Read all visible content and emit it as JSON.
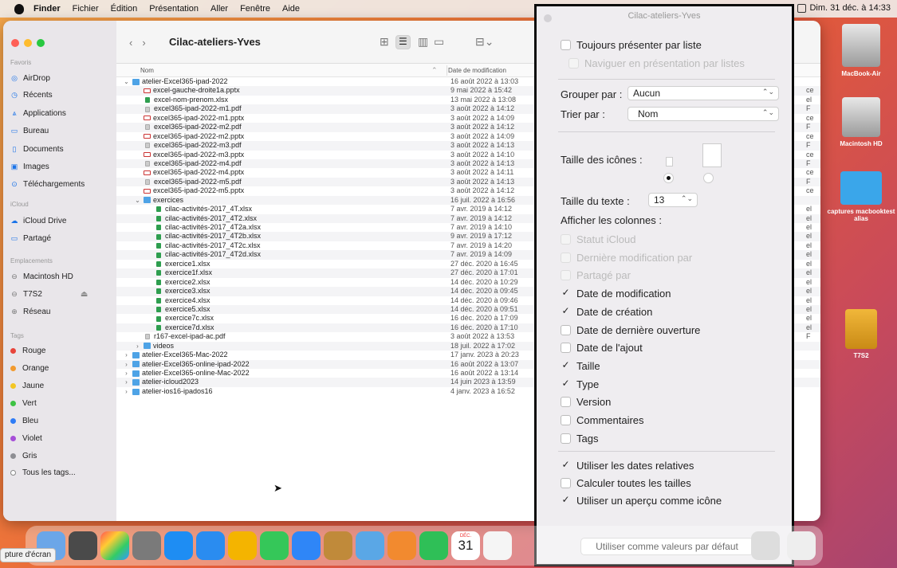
{
  "menubar": {
    "app": "Finder",
    "items": [
      "Fichier",
      "Édition",
      "Présentation",
      "Aller",
      "Fenêtre",
      "Aide"
    ],
    "clock": "Dim. 31 déc. à 14:33"
  },
  "window": {
    "title": "Cilac-ateliers-Yves"
  },
  "sidebar": {
    "favoris_heading": "Favoris",
    "favoris": [
      {
        "label": "AirDrop",
        "icon": "airdrop-icon"
      },
      {
        "label": "Récents",
        "icon": "clock-icon"
      },
      {
        "label": "Applications",
        "icon": "applications-icon"
      },
      {
        "label": "Bureau",
        "icon": "desktop-icon"
      },
      {
        "label": "Documents",
        "icon": "document-icon"
      },
      {
        "label": "Images",
        "icon": "photo-icon"
      },
      {
        "label": "Téléchargements",
        "icon": "download-icon"
      }
    ],
    "icloud_heading": "iCloud",
    "icloud": [
      {
        "label": "iCloud Drive",
        "icon": "cloud-icon"
      },
      {
        "label": "Partagé",
        "icon": "shared-folder-icon"
      }
    ],
    "emplacements_heading": "Emplacements",
    "emplacements": [
      {
        "label": "Macintosh HD",
        "icon": "disk-icon"
      },
      {
        "label": "T7S2",
        "icon": "disk-icon"
      },
      {
        "label": "Réseau",
        "icon": "network-icon"
      }
    ],
    "tags_heading": "Tags",
    "tags": [
      {
        "label": "Rouge",
        "color": "#e8443a"
      },
      {
        "label": "Orange",
        "color": "#f29a2e"
      },
      {
        "label": "Jaune",
        "color": "#f3c623"
      },
      {
        "label": "Vert",
        "color": "#3ec244"
      },
      {
        "label": "Bleu",
        "color": "#2f7cf6"
      },
      {
        "label": "Violet",
        "color": "#a64ed8"
      },
      {
        "label": "Gris",
        "color": "#8e8e93"
      },
      {
        "label": "Tous les tags...",
        "color": "#ffffff"
      }
    ]
  },
  "columns": {
    "name": "Nom",
    "date": "Date de modification"
  },
  "files": [
    {
      "name": "atelier-Excel365-ipad-2022",
      "date": "16 août 2022 à 13:03",
      "type": "folder",
      "indent": 0,
      "tw": "⌄",
      "extra": ""
    },
    {
      "name": "excel-gauche-droite1a.pptx",
      "date": "9 mai 2022 à 15:42",
      "type": "pptx",
      "indent": 1,
      "tw": "",
      "extra": "ce"
    },
    {
      "name": "excel-nom-prenom.xlsx",
      "date": "13 mai 2022 à 13:08",
      "type": "xlsx",
      "indent": 1,
      "tw": "",
      "extra": "el"
    },
    {
      "name": "excel365-ipad-2022-m1.pdf",
      "date": "3 août 2022 à 14:12",
      "type": "pdf",
      "indent": 1,
      "tw": "",
      "extra": "F"
    },
    {
      "name": "excel365-ipad-2022-m1.pptx",
      "date": "3 août 2022 à 14:09",
      "type": "pptx",
      "indent": 1,
      "tw": "",
      "extra": "ce"
    },
    {
      "name": "excel365-ipad-2022-m2.pdf",
      "date": "3 août 2022 à 14:12",
      "type": "pdf",
      "indent": 1,
      "tw": "",
      "extra": "F"
    },
    {
      "name": "excel365-ipad-2022-m2.pptx",
      "date": "3 août 2022 à 14:09",
      "type": "pptx",
      "indent": 1,
      "tw": "",
      "extra": "ce"
    },
    {
      "name": "excel365-ipad-2022-m3.pdf",
      "date": "3 août 2022 à 14:13",
      "type": "pdf",
      "indent": 1,
      "tw": "",
      "extra": "F"
    },
    {
      "name": "excel365-ipad-2022-m3.pptx",
      "date": "3 août 2022 à 14:10",
      "type": "pptx",
      "indent": 1,
      "tw": "",
      "extra": "ce"
    },
    {
      "name": "excel365-ipad-2022-m4.pdf",
      "date": "3 août 2022 à 14:13",
      "type": "pdf",
      "indent": 1,
      "tw": "",
      "extra": "F"
    },
    {
      "name": "excel365-ipad-2022-m4.pptx",
      "date": "3 août 2022 à 14:11",
      "type": "pptx",
      "indent": 1,
      "tw": "",
      "extra": "ce"
    },
    {
      "name": "excel365-ipad-2022-m5.pdf",
      "date": "3 août 2022 à 14:13",
      "type": "pdf",
      "indent": 1,
      "tw": "",
      "extra": "F"
    },
    {
      "name": "excel365-ipad-2022-m5.pptx",
      "date": "3 août 2022 à 14:12",
      "type": "pptx",
      "indent": 1,
      "tw": "",
      "extra": "ce"
    },
    {
      "name": "exercices",
      "date": "16 juil. 2022 à 16:56",
      "type": "folder",
      "indent": 1,
      "tw": "⌄",
      "extra": ""
    },
    {
      "name": "cilac-activités-2017_4T.xlsx",
      "date": "7 avr. 2019 à 14:12",
      "type": "xlsx",
      "indent": 2,
      "tw": "",
      "extra": "el"
    },
    {
      "name": "cilac-activités-2017_4T2.xlsx",
      "date": "7 avr. 2019 à 14:12",
      "type": "xlsx",
      "indent": 2,
      "tw": "",
      "extra": "el"
    },
    {
      "name": "cilac-activités-2017_4T2a.xlsx",
      "date": "7 avr. 2019 à 14:10",
      "type": "xlsx",
      "indent": 2,
      "tw": "",
      "extra": "el"
    },
    {
      "name": "cilac-activités-2017_4T2b.xlsx",
      "date": "9 avr. 2019 à 17:12",
      "type": "xlsx",
      "indent": 2,
      "tw": "",
      "extra": "el"
    },
    {
      "name": "cilac-activités-2017_4T2c.xlsx",
      "date": "7 avr. 2019 à 14:20",
      "type": "xlsx",
      "indent": 2,
      "tw": "",
      "extra": "el"
    },
    {
      "name": "cilac-activités-2017_4T2d.xlsx",
      "date": "7 avr. 2019 à 14:09",
      "type": "xlsx",
      "indent": 2,
      "tw": "",
      "extra": "el"
    },
    {
      "name": "exercice1.xlsx",
      "date": "27 déc. 2020 à 16:45",
      "type": "xlsx",
      "indent": 2,
      "tw": "",
      "extra": "el"
    },
    {
      "name": "exercice1f.xlsx",
      "date": "27 déc. 2020 à 17:01",
      "type": "xlsx",
      "indent": 2,
      "tw": "",
      "extra": "el"
    },
    {
      "name": "exercice2.xlsx",
      "date": "14 déc. 2020 à 10:29",
      "type": "xlsx",
      "indent": 2,
      "tw": "",
      "extra": "el"
    },
    {
      "name": "exercice3.xlsx",
      "date": "14 déc. 2020 à 09:45",
      "type": "xlsx",
      "indent": 2,
      "tw": "",
      "extra": "el"
    },
    {
      "name": "exercice4.xlsx",
      "date": "14 déc. 2020 à 09:46",
      "type": "xlsx",
      "indent": 2,
      "tw": "",
      "extra": "el"
    },
    {
      "name": "exercice5.xlsx",
      "date": "14 déc. 2020 à 09:51",
      "type": "xlsx",
      "indent": 2,
      "tw": "",
      "extra": "el"
    },
    {
      "name": "exercice7c.xlsx",
      "date": "16 déc. 2020 à 17:09",
      "type": "xlsx",
      "indent": 2,
      "tw": "",
      "extra": "el"
    },
    {
      "name": "exercice7d.xlsx",
      "date": "16 déc. 2020 à 17:10",
      "type": "xlsx",
      "indent": 2,
      "tw": "",
      "extra": "el"
    },
    {
      "name": "r167-excel-ipad-ac.pdf",
      "date": "3 août 2022 à 13:53",
      "type": "pdf",
      "indent": 1,
      "tw": "",
      "extra": "F"
    },
    {
      "name": "videos",
      "date": "18 juil. 2022 à 17:02",
      "type": "folder",
      "indent": 1,
      "tw": "›",
      "extra": ""
    },
    {
      "name": "atelier-Excel365-Mac-2022",
      "date": "17 janv. 2023 à 20:23",
      "type": "folder",
      "indent": 0,
      "tw": "›",
      "extra": ""
    },
    {
      "name": "atelier-Excel365-online-ipad-2022",
      "date": "16 août 2022 à 13:07",
      "type": "folder",
      "indent": 0,
      "tw": "›",
      "extra": ""
    },
    {
      "name": "atelier-Excel365-online-Mac-2022",
      "date": "16 août 2022 à 13:14",
      "type": "folder",
      "indent": 0,
      "tw": "›",
      "extra": ""
    },
    {
      "name": "atelier-icloud2023",
      "date": "14 juin 2023 à 13:59",
      "type": "folder",
      "indent": 0,
      "tw": "›",
      "extra": ""
    },
    {
      "name": "atelier-ios16-ipados16",
      "date": "4 janv. 2023 à 16:52",
      "type": "folder",
      "indent": 0,
      "tw": "›",
      "extra": ""
    }
  ],
  "view_options": {
    "title": "Cilac-ateliers-Yves",
    "always_list": "Toujours présenter par liste",
    "browse_list": "Naviguer en présentation par listes",
    "group_by_label": "Grouper par :",
    "group_by_value": "Aucun",
    "sort_by_label": "Trier par :",
    "sort_by_value": "Nom",
    "icon_size_label": "Taille des icônes :",
    "icon_size_selected": "small",
    "text_size_label": "Taille du texte :",
    "text_size_value": "13",
    "columns_label": "Afficher les colonnes :",
    "columns": [
      {
        "label": "Statut iCloud",
        "checked": false,
        "disabled": true
      },
      {
        "label": "Dernière modification par",
        "checked": false,
        "disabled": true
      },
      {
        "label": "Partagé par",
        "checked": false,
        "disabled": true
      },
      {
        "label": "Date de modification",
        "checked": true,
        "disabled": false
      },
      {
        "label": "Date de création",
        "checked": true,
        "disabled": false
      },
      {
        "label": "Date de dernière ouverture",
        "checked": false,
        "disabled": false
      },
      {
        "label": "Date de l'ajout",
        "checked": false,
        "disabled": false
      },
      {
        "label": "Taille",
        "checked": true,
        "disabled": false
      },
      {
        "label": "Type",
        "checked": true,
        "disabled": false
      },
      {
        "label": "Version",
        "checked": false,
        "disabled": false
      },
      {
        "label": "Commentaires",
        "checked": false,
        "disabled": false
      },
      {
        "label": "Tags",
        "checked": false,
        "disabled": false
      }
    ],
    "options": [
      {
        "label": "Utiliser les dates relatives",
        "checked": true
      },
      {
        "label": "Calculer toutes les tailles",
        "checked": false
      },
      {
        "label": "Utiliser un aperçu comme icône",
        "checked": true
      }
    ],
    "default_button": "Utiliser comme valeurs par défaut"
  },
  "desktop": {
    "items": [
      {
        "label": "MacBook-Air",
        "icon": "disk-icon"
      },
      {
        "label": "Macintosh HD",
        "icon": "disk-icon"
      },
      {
        "label": "captures macbooktest alias",
        "icon": "folder-icon"
      },
      {
        "label": "T7S2",
        "icon": "external-drive-icon"
      }
    ]
  },
  "dock": {
    "tooltip": "pture d'écran",
    "calendar_month": "DÉC.",
    "calendar_day": "31"
  },
  "colors": {
    "folder": "#4ea3e6",
    "xlsx": "#2e9e4f",
    "pptx": "#cc3333",
    "accent": "#1a73e8"
  }
}
